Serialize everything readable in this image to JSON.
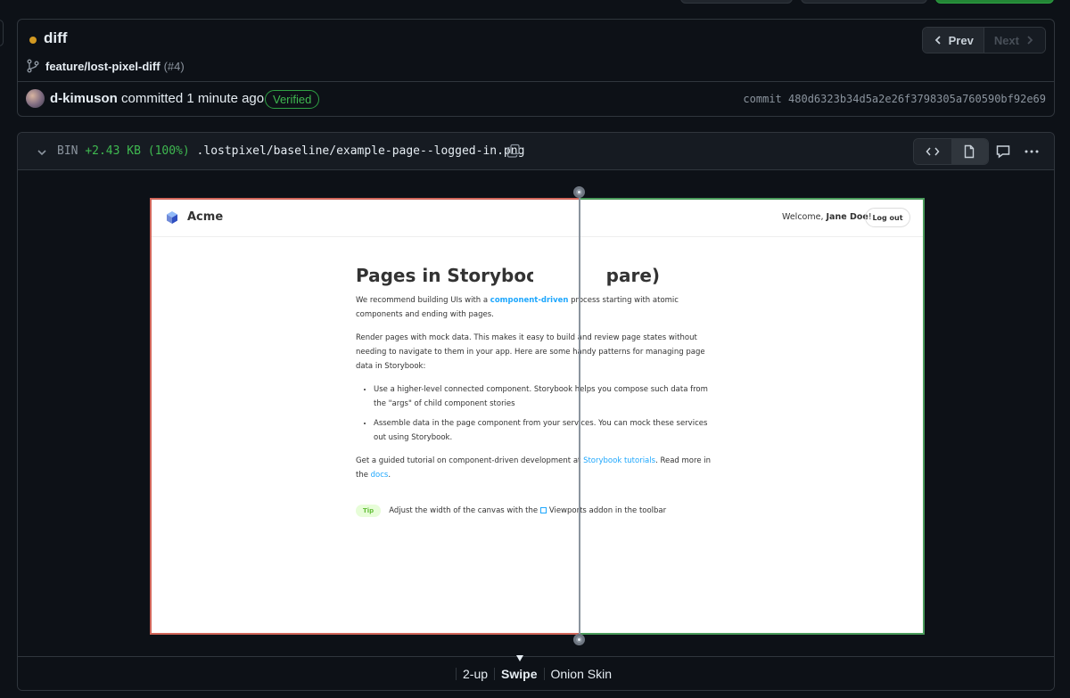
{
  "commit": {
    "title": "diff",
    "branch": "feature/lost-pixel-diff",
    "pr_ref": "(#4)",
    "author": "d-kimuson",
    "action": "committed",
    "time": "1 minute ago",
    "verified": "Verified",
    "sha_prefix": "commit",
    "sha": "480d6323b34d5a2e26f3798305a760590bf92e69",
    "status_color": "#d29922"
  },
  "pager": {
    "prev": "Prev",
    "next": "Next"
  },
  "file": {
    "type": "BIN",
    "size_change": "+2.43 KB (100%)",
    "path": ".lostpixel/baseline/example-page--logged-in.png"
  },
  "diff_modes": [
    {
      "label": "2-up",
      "active": false
    },
    {
      "label": "Swipe",
      "active": true
    },
    {
      "label": "Onion Skin",
      "active": false
    }
  ],
  "storybook": {
    "brand": "Acme",
    "welcome_prefix": "Welcome, ",
    "user_name": "Jane Doe",
    "welcome_suffix": "!",
    "logout": "Log out",
    "title": "Pages in Storybook (compare)",
    "p1_a": "We recommend building UIs with a ",
    "p1_link": "component-driven",
    "p1_b": " process starting with atomic components and ending with pages.",
    "p2": "Render pages with mock data. This makes it easy to build and review page states without needing to navigate to them in your app. Here are some handy patterns for managing page data in Storybook:",
    "li1": "Use a higher-level connected component. Storybook helps you compose such data from the \"args\" of child component stories",
    "li2": "Assemble data in the page component from your services. You can mock these services out using Storybook.",
    "p3_a": "Get a guided tutorial on component-driven development at ",
    "p3_link1": "Storybook tutorials",
    "p3_b": ". Read more in the ",
    "p3_link2": "docs",
    "p3_c": ".",
    "tip_badge": "Tip",
    "tip_a": "Adjust the width of the canvas with the ",
    "tip_b": "Viewports addon in the toolbar"
  }
}
